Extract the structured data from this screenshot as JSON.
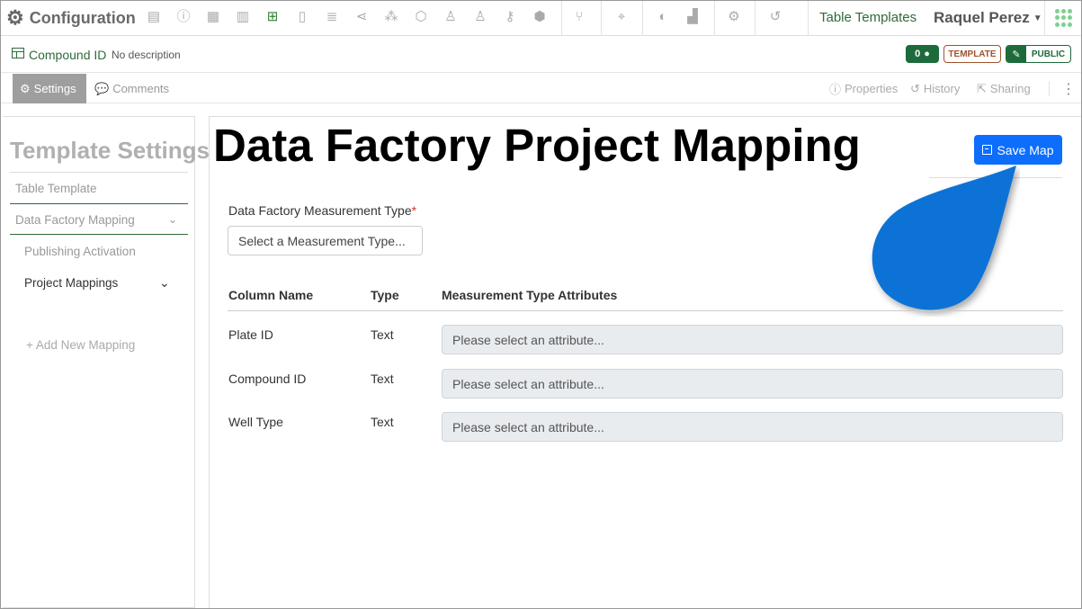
{
  "app": {
    "title": "Configuration",
    "section_link": "Table Templates",
    "user": "Raquel Perez"
  },
  "toolbar_icons": [
    "form-icon",
    "info-icon",
    "grid-icon",
    "notebook-icon",
    "table-icon",
    "document-icon",
    "database-icon",
    "share-icon",
    "network-icon",
    "hexagon-icon",
    "users-icon",
    "user-icon",
    "key-icon",
    "cube-icon",
    "workflow-icon",
    "location-icon",
    "shield-icon",
    "factory-icon",
    "settings-icon",
    "history-icon"
  ],
  "record": {
    "title": "Compound ID",
    "description": "No description",
    "comment_count": "0",
    "template_badge": "TEMPLATE",
    "public_badge": "PUBLIC"
  },
  "tabs": {
    "settings": "Settings",
    "comments": "Comments",
    "properties": "Properties",
    "history": "History",
    "sharing": "Sharing"
  },
  "sidebar": {
    "title": "Template Settings",
    "items": [
      "Table Template",
      "Data Factory Mapping",
      "Publishing Activation",
      "Project Mappings"
    ],
    "add_label": "Add New Mapping"
  },
  "main": {
    "heading": "Data Factory Project Mapping",
    "save_label": "Save Map",
    "measurement_label": "Data Factory Measurement Type",
    "measurement_required": "*",
    "measurement_placeholder": "Select a Measurement Type...",
    "columns": [
      "Column Name",
      "Type",
      "Measurement Type Attributes"
    ],
    "rows": [
      {
        "name": "Plate ID",
        "type": "Text",
        "attribute": "Please select an attribute..."
      },
      {
        "name": "Compound ID",
        "type": "Text",
        "attribute": "Please select an attribute..."
      },
      {
        "name": "Well Type",
        "type": "Text",
        "attribute": "Please select an attribute..."
      }
    ]
  },
  "colors": {
    "brand_green": "#2e6b3a",
    "primary_blue": "#0d6efd",
    "callout_blue": "#0b72d6"
  }
}
